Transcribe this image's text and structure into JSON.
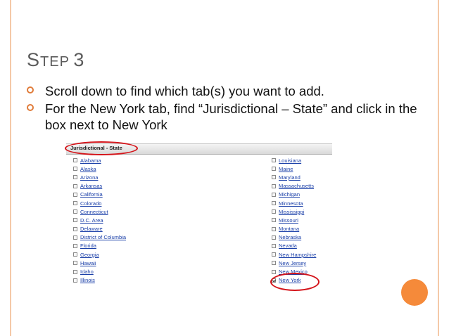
{
  "slide": {
    "title_cap": "S",
    "title_rest": "TEP",
    "title_num": "3",
    "bullets": [
      "Scroll down to find which tab(s) you want to add.",
      "For the New York tab, find “Jurisdictional – State” and click in the box next to New York"
    ]
  },
  "panel": {
    "header": "Jurisdictional - State",
    "left_column": [
      {
        "label": "Alabama",
        "checked": false
      },
      {
        "label": "Alaska",
        "checked": false
      },
      {
        "label": "Arizona",
        "checked": false
      },
      {
        "label": "Arkansas",
        "checked": false
      },
      {
        "label": "California",
        "checked": false
      },
      {
        "label": "Colorado",
        "checked": false
      },
      {
        "label": "Connecticut",
        "checked": false
      },
      {
        "label": "D.C. Area",
        "checked": false
      },
      {
        "label": "Delaware",
        "checked": false
      },
      {
        "label": "District of Columbia",
        "checked": false
      },
      {
        "label": "Florida",
        "checked": false
      },
      {
        "label": "Georgia",
        "checked": false
      },
      {
        "label": "Hawaii",
        "checked": false
      },
      {
        "label": "Idaho",
        "checked": false
      },
      {
        "label": "Illinois",
        "checked": false
      }
    ],
    "right_column": [
      {
        "label": "Louisiana",
        "checked": false
      },
      {
        "label": "Maine",
        "checked": false
      },
      {
        "label": "Maryland",
        "checked": false
      },
      {
        "label": "Massachusetts",
        "checked": false
      },
      {
        "label": "Michigan",
        "checked": false
      },
      {
        "label": "Minnesota",
        "checked": false
      },
      {
        "label": "Mississippi",
        "checked": false
      },
      {
        "label": "Missouri",
        "checked": false
      },
      {
        "label": "Montana",
        "checked": false
      },
      {
        "label": "Nebraska",
        "checked": false
      },
      {
        "label": "Nevada",
        "checked": false
      },
      {
        "label": "New Hampshire",
        "checked": false
      },
      {
        "label": "New Jersey",
        "checked": false
      },
      {
        "label": "New Mexico",
        "checked": false
      },
      {
        "label": "New York",
        "checked": true
      }
    ]
  },
  "colors": {
    "accent_orange": "#f58a3a",
    "frame": "#f4c9a8",
    "highlight_red": "#d4141a",
    "link_blue": "#1a3fa8"
  }
}
